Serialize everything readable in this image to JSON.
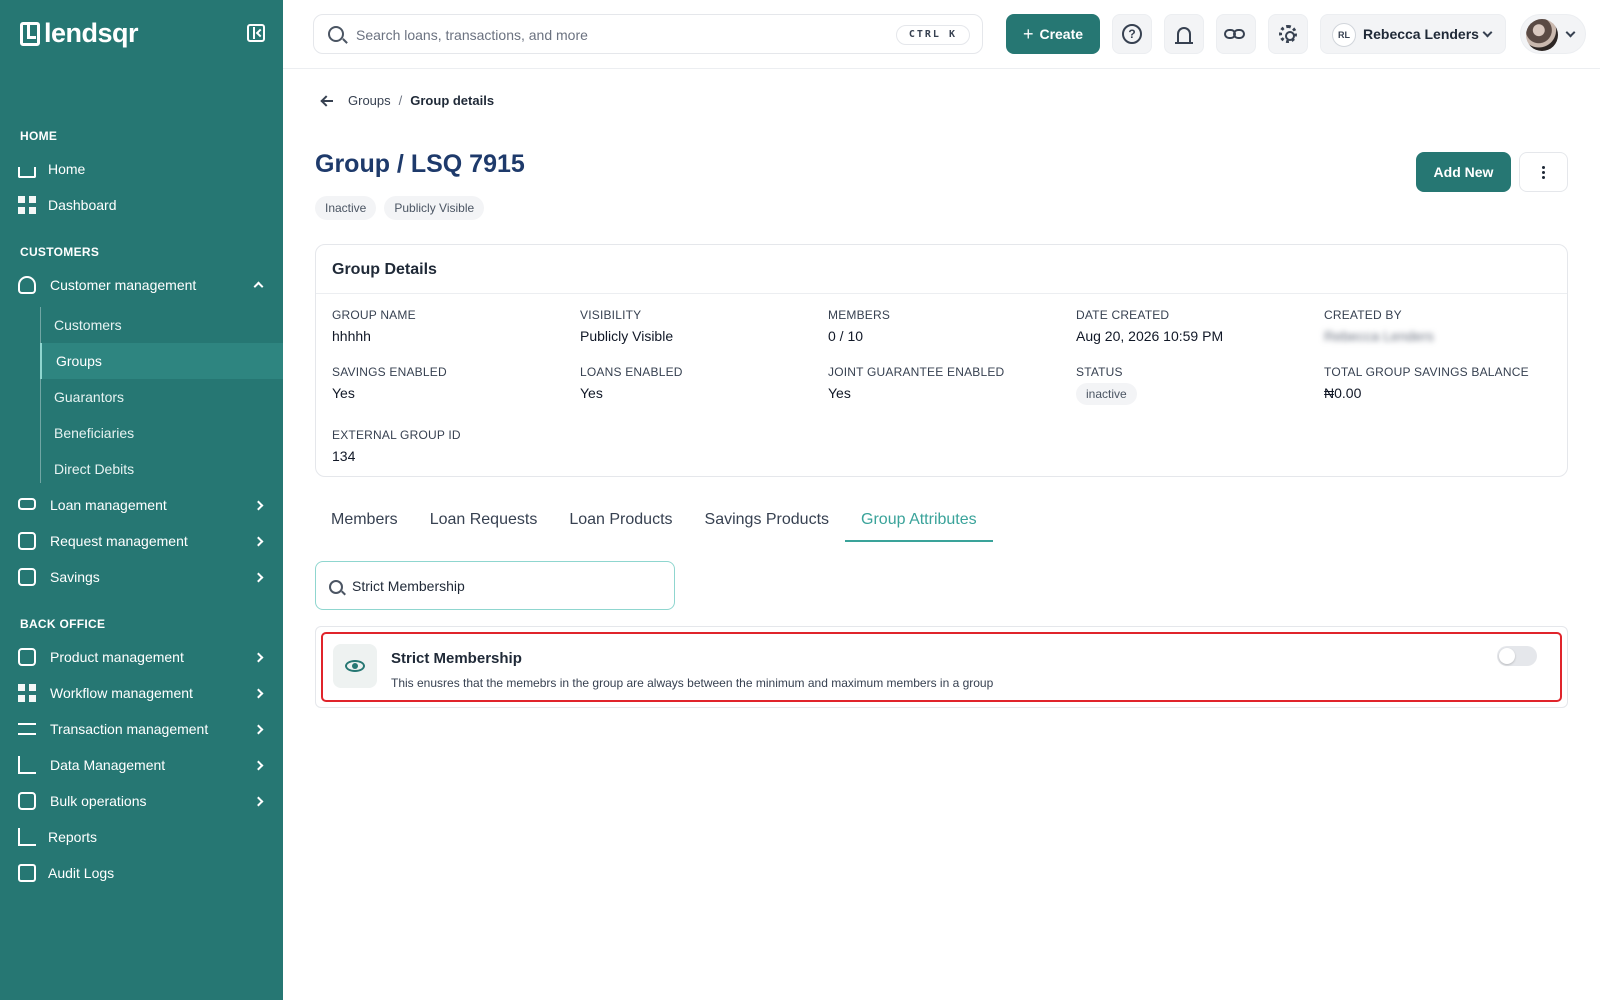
{
  "app": {
    "logo_text": "lendsqr"
  },
  "colors": {
    "sidebar_bg": "#267773",
    "accent": "#3aa39a",
    "title": "#1e3a6b",
    "highlight_border": "#e0242b"
  },
  "sidebar": {
    "sections": {
      "home": "HOME",
      "customers": "CUSTOMERS",
      "back_office": "BACK OFFICE"
    },
    "items": {
      "home": {
        "label": "Home",
        "icon": "home-icon"
      },
      "dashboard": {
        "label": "Dashboard",
        "icon": "dashboard-icon"
      },
      "customer_management": {
        "label": "Customer management",
        "icon": "users-icon",
        "expanded": true
      },
      "loan_management": {
        "label": "Loan management",
        "icon": "loan-icon"
      },
      "request_management": {
        "label": "Request management",
        "icon": "inbox-icon"
      },
      "savings": {
        "label": "Savings",
        "icon": "savings-icon"
      },
      "product_management": {
        "label": "Product management",
        "icon": "package-icon"
      },
      "workflow_management": {
        "label": "Workflow management",
        "icon": "workflow-icon"
      },
      "transaction_management": {
        "label": "Transaction management",
        "icon": "swap-icon"
      },
      "data_management": {
        "label": "Data Management",
        "icon": "chart-icon"
      },
      "bulk_operations": {
        "label": "Bulk operations",
        "icon": "inbox-icon"
      },
      "reports": {
        "label": "Reports",
        "icon": "chart-icon"
      },
      "audit_logs": {
        "label": "Audit Logs",
        "icon": "clipboard-icon"
      }
    },
    "sub_items": {
      "customers": "Customers",
      "groups": "Groups",
      "guarantors": "Guarantors",
      "beneficiaries": "Beneficiaries",
      "direct_debits": "Direct Debits"
    },
    "active_sub_item": "Groups"
  },
  "header": {
    "search_placeholder": "Search loans, transactions, and more",
    "shortcut": "CTRL K",
    "create_label": "Create",
    "user_initials": "RL",
    "user_name": "Rebecca Lenders"
  },
  "breadcrumb": {
    "parent": "Groups",
    "separator": "/",
    "current": "Group details"
  },
  "page": {
    "title": "Group / LSQ 7915",
    "badges": [
      "Inactive",
      "Publicly Visible"
    ],
    "add_new_label": "Add New"
  },
  "group_details": {
    "title": "Group Details",
    "fields": {
      "group_name": {
        "label": "GROUP NAME",
        "value": "hhhhh"
      },
      "visibility": {
        "label": "VISIBILITY",
        "value": "Publicly Visible"
      },
      "members": {
        "label": "MEMBERS",
        "value": "0 / 10"
      },
      "date_created": {
        "label": "DATE CREATED",
        "value": "Aug 20, 2026 10:59 PM"
      },
      "created_by": {
        "label": "CREATED BY",
        "value": "Rebecca Lenders"
      },
      "savings_enabled": {
        "label": "SAVINGS ENABLED",
        "value": "Yes"
      },
      "loans_enabled": {
        "label": "LOANS ENABLED",
        "value": "Yes"
      },
      "joint_guarantee": {
        "label": "JOINT GUARANTEE ENABLED",
        "value": "Yes"
      },
      "status": {
        "label": "STATUS",
        "value": "inactive"
      },
      "total_savings": {
        "label": "TOTAL GROUP SAVINGS BALANCE",
        "value": "₦0.00"
      },
      "external_id": {
        "label": "EXTERNAL GROUP ID",
        "value": "134"
      }
    }
  },
  "tabs": {
    "members": "Members",
    "loan_requests": "Loan Requests",
    "loan_products": "Loan Products",
    "savings_products": "Savings Products",
    "group_attributes": "Group Attributes",
    "active": "Group Attributes"
  },
  "attributes": {
    "search_value": "Strict Membership",
    "items": [
      {
        "name": "Strict Membership",
        "description": "This enusres that the memebrs in the group are always between the minimum and maximum members in a group",
        "enabled": false
      }
    ]
  }
}
